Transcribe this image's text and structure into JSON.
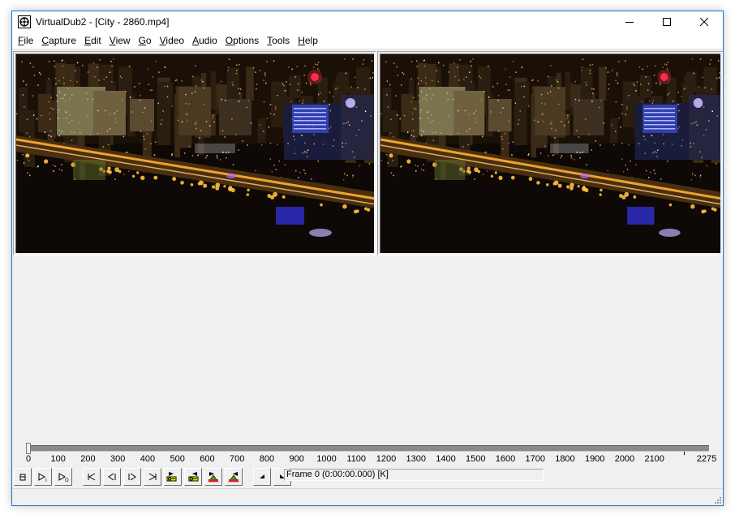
{
  "window": {
    "app_name": "VirtualDub2",
    "title": "VirtualDub2 - [City - 2860.mp4]"
  },
  "menu": [
    {
      "label": "File",
      "key": "F",
      "rest": "ile"
    },
    {
      "label": "Capture",
      "key": "C",
      "rest": "apture"
    },
    {
      "label": "Edit",
      "key": "E",
      "rest": "dit"
    },
    {
      "label": "View",
      "key": "V",
      "rest": "iew"
    },
    {
      "label": "Go",
      "key": "G",
      "rest": "o"
    },
    {
      "label": "Video",
      "key": "V",
      "rest": "ideo"
    },
    {
      "label": "Audio",
      "key": "A",
      "rest": "udio"
    },
    {
      "label": "Options",
      "key": "O",
      "rest": "ptions"
    },
    {
      "label": "Tools",
      "key": "T",
      "rest": "ools"
    },
    {
      "label": "Help",
      "key": "H",
      "rest": "elp"
    }
  ],
  "panes": {
    "input": "input-video-pane",
    "output": "output-video-pane"
  },
  "timeline": {
    "position": 0,
    "total_frames": 2275,
    "tick_labels": [
      "0",
      "100",
      "200",
      "300",
      "400",
      "500",
      "600",
      "700",
      "800",
      "900",
      "1000",
      "1100",
      "1200",
      "1300",
      "1400",
      "1500",
      "1600",
      "1700",
      "1800",
      "1900",
      "2000",
      "2100",
      "2275"
    ]
  },
  "toolbar": {
    "buttons": [
      {
        "name": "stop-icon"
      },
      {
        "name": "play-input-icon"
      },
      {
        "name": "play-output-icon"
      },
      {
        "name": "go-start-icon"
      },
      {
        "name": "prev-frame-icon"
      },
      {
        "name": "next-frame-icon"
      },
      {
        "name": "go-end-icon"
      },
      {
        "name": "prev-keyframe-icon"
      },
      {
        "name": "next-keyframe-icon"
      },
      {
        "name": "prev-scene-icon"
      },
      {
        "name": "next-scene-icon"
      },
      {
        "name": "mark-in-icon"
      },
      {
        "name": "mark-out-icon"
      }
    ]
  },
  "frame_info": "Frame 0 (0:00:00.000) [K]"
}
